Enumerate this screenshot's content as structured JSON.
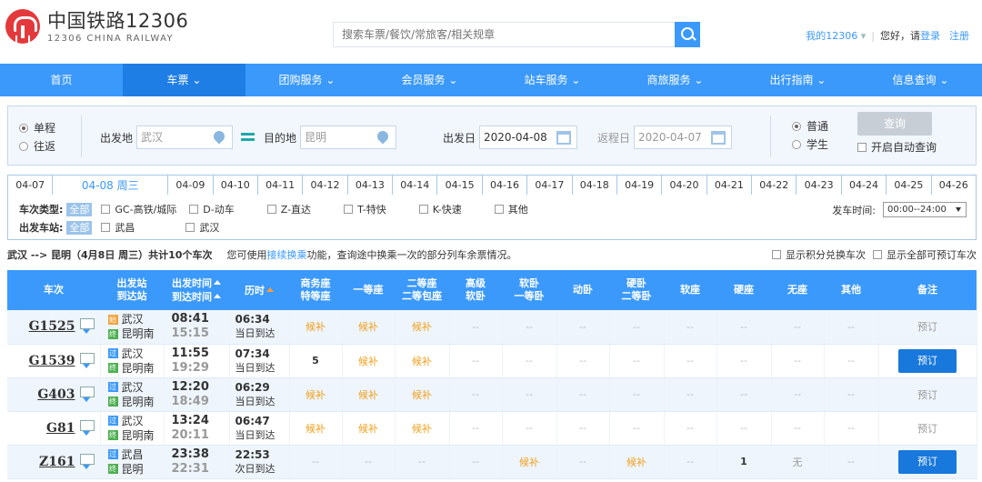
{
  "header": {
    "logo_cn": "中国铁路12306",
    "logo_en": "12306 CHINA RAILWAY",
    "search_placeholder": "搜索车票/餐饮/常旅客/相关规章",
    "my12306": "我的12306",
    "greeting": "您好，请",
    "login": "登录",
    "register": "注册"
  },
  "nav": [
    "首页",
    "车票",
    "团购服务",
    "会员服务",
    "站车服务",
    "商旅服务",
    "出行指南",
    "信息查询"
  ],
  "query": {
    "trip_oneway": "单程",
    "trip_round": "往返",
    "from_label": "出发地",
    "from_value": "武汉",
    "to_label": "目的地",
    "to_value": "昆明",
    "depart_label": "出发日",
    "depart_value": "2020-04-08",
    "return_label": "返程日",
    "return_value": "2020-04-07",
    "type_normal": "普通",
    "type_student": "学生",
    "query_btn": "查询",
    "auto_query": "开启自动查询"
  },
  "dates": [
    "04-07",
    "04-08 周三",
    "04-09",
    "04-10",
    "04-11",
    "04-12",
    "04-13",
    "04-14",
    "04-15",
    "04-16",
    "04-17",
    "04-18",
    "04-19",
    "04-20",
    "04-21",
    "04-22",
    "04-23",
    "04-24",
    "04-25",
    "04-26"
  ],
  "filters": {
    "type_title": "车次类型:",
    "all": "全部",
    "types": [
      "GC-高铁/城际",
      "D-动车",
      "Z-直达",
      "T-特快",
      "K-快速",
      "其他"
    ],
    "station_title": "出发车站:",
    "stations": [
      "武昌",
      "武汉"
    ],
    "time_label": "发车时间:",
    "time_value": "00:00--24:00"
  },
  "summary": {
    "route": "武汉 --> 昆明（4月8日  周三）共计",
    "count": "10",
    "unit": "个车次",
    "tip_pre": "您可使用",
    "tip_link": "接续换乘",
    "tip_post": "功能，查询途中换乘一次的部分列车余票情况。",
    "opt1": "显示积分兑换车次",
    "opt2": "显示全部可预订车次"
  },
  "columns": [
    {
      "l1": "车次",
      "l2": ""
    },
    {
      "l1": "出发站",
      "l2": "到达站"
    },
    {
      "l1": "出发时间",
      "l2": "到达时间"
    },
    {
      "l1": "历时",
      "l2": ""
    },
    {
      "l1": "商务座",
      "l2": "特等座"
    },
    {
      "l1": "一等座",
      "l2": ""
    },
    {
      "l1": "二等座",
      "l2": "二等包座"
    },
    {
      "l1": "高级",
      "l2": "软卧"
    },
    {
      "l1": "软卧",
      "l2": "一等卧"
    },
    {
      "l1": "动卧",
      "l2": ""
    },
    {
      "l1": "硬卧",
      "l2": "二等卧"
    },
    {
      "l1": "软座",
      "l2": ""
    },
    {
      "l1": "硬座",
      "l2": ""
    },
    {
      "l1": "无座",
      "l2": ""
    },
    {
      "l1": "其他",
      "l2": ""
    },
    {
      "l1": "备注",
      "l2": ""
    }
  ],
  "trains": [
    {
      "no": "G1525",
      "from": "武汉",
      "to": "昆明南",
      "fb": "始",
      "tb": "终",
      "dep": "08:41",
      "arr": "15:15",
      "dur": "06:34",
      "day": "当日到达",
      "seats": [
        "候补",
        "候补",
        "候补",
        "--",
        "--",
        "--",
        "--",
        "--",
        "--",
        "--",
        "--"
      ],
      "note": "预订",
      "book": false
    },
    {
      "no": "G1539",
      "from": "武汉",
      "to": "昆明南",
      "fb": "过",
      "tb": "终",
      "dep": "11:55",
      "arr": "19:29",
      "dur": "07:34",
      "day": "当日到达",
      "seats": [
        "5",
        "候补",
        "候补",
        "--",
        "--",
        "--",
        "--",
        "--",
        "--",
        "--",
        "--"
      ],
      "note": "预订",
      "book": true
    },
    {
      "no": "G403",
      "from": "武汉",
      "to": "昆明南",
      "fb": "过",
      "tb": "终",
      "dep": "12:20",
      "arr": "18:49",
      "dur": "06:29",
      "day": "当日到达",
      "seats": [
        "候补",
        "候补",
        "候补",
        "--",
        "--",
        "--",
        "--",
        "--",
        "--",
        "--",
        "--"
      ],
      "note": "预订",
      "book": false
    },
    {
      "no": "G81",
      "from": "武汉",
      "to": "昆明南",
      "fb": "过",
      "tb": "终",
      "dep": "13:24",
      "arr": "20:11",
      "dur": "06:47",
      "day": "当日到达",
      "seats": [
        "候补",
        "候补",
        "候补",
        "--",
        "--",
        "--",
        "--",
        "--",
        "--",
        "--",
        "--"
      ],
      "note": "预订",
      "book": false
    },
    {
      "no": "Z161",
      "from": "武昌",
      "to": "昆明",
      "fb": "过",
      "tb": "终",
      "dep": "23:38",
      "arr": "22:31",
      "dur": "22:53",
      "day": "次日到达",
      "seats": [
        "--",
        "--",
        "--",
        "--",
        "候补",
        "--",
        "候补",
        "--",
        "1",
        "无",
        "--"
      ],
      "note": "预订",
      "book": true
    }
  ],
  "colors": {
    "primary": "#3b99fc",
    "nav_active": "#1e7ee6",
    "waitlist": "#f0a11e",
    "book_btn": "#1878dc"
  }
}
